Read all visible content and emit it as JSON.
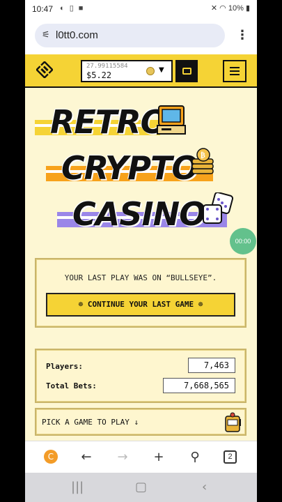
{
  "status_bar": {
    "time": "10:47",
    "battery": "10%"
  },
  "browser": {
    "url": "l0tt0.com",
    "tab_count": "2"
  },
  "header": {
    "wallet_small": "27.99115584",
    "wallet_balance": "$5.22"
  },
  "hero": {
    "line1": "RETRO",
    "line2": "CRYPTO",
    "line3": "CASINO"
  },
  "last_play": {
    "text": "YOUR LAST PLAY WAS ON “BULLSEYE”.",
    "button": "☸ CONTINUE YOUR LAST GAME ☸"
  },
  "stats": {
    "players_label": "Players:",
    "players_value": "7,463",
    "bets_label": "Total Bets:",
    "bets_value": "7,668,565"
  },
  "pick": {
    "label": "PICK A GAME TO PLAY ↓"
  },
  "overlay": {
    "timer": "00:00"
  },
  "colors": {
    "accent": "#f5d335",
    "bg": "#fdf7d3",
    "orange": "#f7a21b",
    "purple": "#9a86e8"
  }
}
